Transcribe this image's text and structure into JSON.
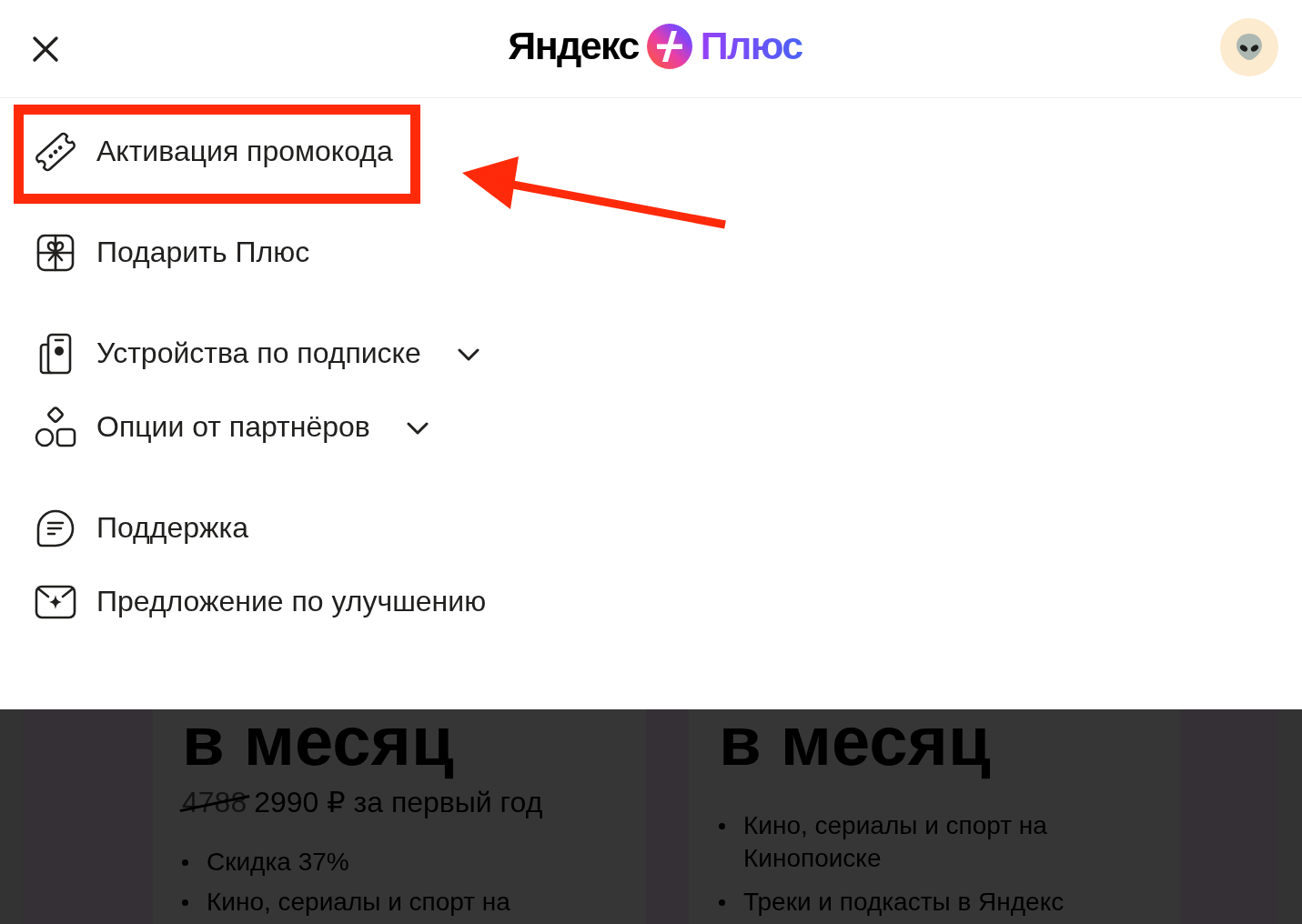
{
  "header": {
    "logo": {
      "wordmark": "Яндекс",
      "product": "Плюс"
    }
  },
  "menu": {
    "sections": [
      {
        "items": [
          {
            "kind": "link",
            "label": "Активация промокода",
            "highlighted": true
          }
        ]
      },
      {
        "items": [
          {
            "kind": "link",
            "label": "Подарить Плюс",
            "highlighted": false
          }
        ]
      },
      {
        "items": [
          {
            "kind": "dropdown",
            "label": "Устройства по подписке",
            "expanded": false,
            "highlighted": false
          },
          {
            "kind": "dropdown",
            "label": "Опции от партнёров",
            "expanded": false,
            "highlighted": false
          }
        ]
      },
      {
        "items": [
          {
            "kind": "link",
            "label": "Поддержка",
            "highlighted": false
          },
          {
            "kind": "link",
            "label": "Предложение по улучшению",
            "highlighted": false
          }
        ]
      }
    ]
  },
  "background_page": {
    "cards": [
      {
        "heading": "в месяц",
        "old_price": "4788",
        "price": "2990 ₽ за первый год",
        "bullets": [
          "Скидка 37%",
          "Кино, сериалы и спорт на"
        ]
      },
      {
        "heading": "в месяц",
        "bullets": [
          "Кино, сериалы и спорт на Кинопоиске",
          "Треки и подкасты в Яндекс"
        ]
      }
    ]
  }
}
